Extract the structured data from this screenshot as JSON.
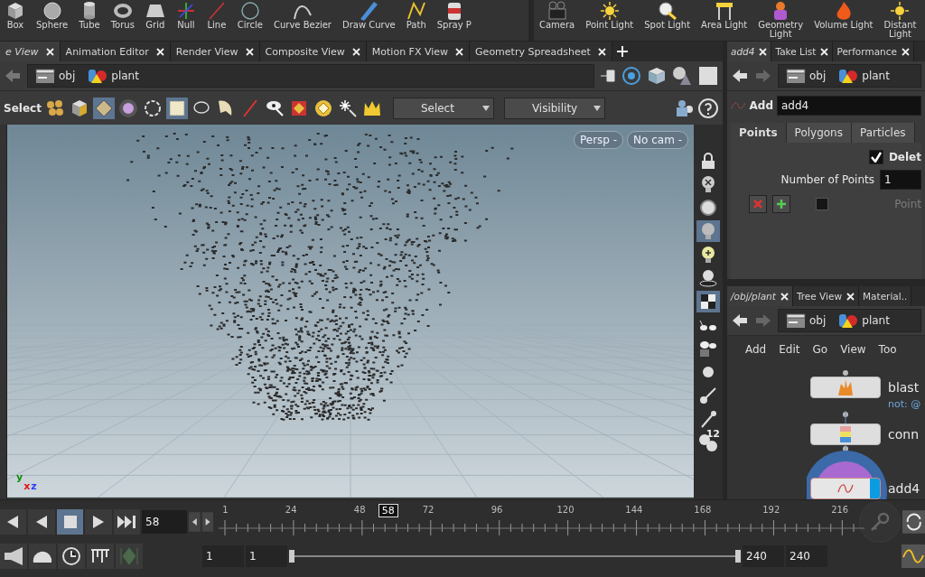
{
  "shelf_tools": [
    {
      "label": "Box"
    },
    {
      "label": "Sphere"
    },
    {
      "label": "Tube"
    },
    {
      "label": "Torus"
    },
    {
      "label": "Grid"
    },
    {
      "label": "Null"
    },
    {
      "label": "Line"
    },
    {
      "label": "Circle"
    },
    {
      "label": "Curve Bezier"
    },
    {
      "label": "Draw Curve"
    },
    {
      "label": "Path"
    },
    {
      "label": "Spray P"
    }
  ],
  "light_tools": [
    {
      "label": "Camera"
    },
    {
      "label": "Point Light"
    },
    {
      "label": "Spot Light"
    },
    {
      "label": "Area Light"
    },
    {
      "label": "Geometry\nLight"
    },
    {
      "label": "Volume Light"
    },
    {
      "label": "Distant\nLight"
    }
  ],
  "viewer_tabs": [
    {
      "label": "e View",
      "selected": true
    },
    {
      "label": "Animation Editor",
      "selected": false
    },
    {
      "label": "Render View",
      "selected": false
    },
    {
      "label": "Composite View",
      "selected": false
    },
    {
      "label": "Motion FX View",
      "selected": false
    },
    {
      "label": "Geometry Spreadsheet",
      "selected": false
    }
  ],
  "viewer_path": [
    "obj",
    "plant"
  ],
  "viewer_toolbar": {
    "label": "Select",
    "tools": [
      {
        "selected": false
      },
      {
        "selected": false
      },
      {
        "selected": true
      },
      {
        "selected": false
      },
      {
        "selected": false
      },
      {
        "selected": true
      },
      {
        "selected": false
      },
      {
        "selected": false
      },
      {
        "selected": false
      },
      {
        "selected": false
      },
      {
        "selected": false
      },
      {
        "selected": false
      },
      {
        "selected": false
      },
      {
        "selected": false
      }
    ],
    "dropdowns": [
      "Select",
      "Visibility"
    ]
  },
  "viewport": {
    "camera_buttons": [
      "Persp -",
      "No cam -"
    ],
    "axes": [
      "y",
      "x",
      "z"
    ],
    "display_tools": [
      {
        "selected": false
      },
      {
        "selected": false
      },
      {
        "selected": false
      },
      {
        "selected": true
      },
      {
        "selected": false
      },
      {
        "selected": false
      },
      {
        "selected": true
      },
      {
        "selected": false
      },
      {
        "selected": false
      },
      {
        "selected": false
      },
      {
        "selected": false
      },
      {
        "selected": false
      },
      {
        "selected": false
      }
    ],
    "point_count_label": "12"
  },
  "parameter_tabs": [
    {
      "label": "add4",
      "selected": true
    },
    {
      "label": "Take List",
      "selected": false
    },
    {
      "label": "Performance",
      "selected": false
    }
  ],
  "parameter_path": [
    "obj",
    "plant"
  ],
  "node": {
    "type": "Add",
    "name": "add4"
  },
  "parm_tabs": [
    {
      "label": "Points",
      "selected": true
    },
    {
      "label": "Polygons",
      "selected": false
    },
    {
      "label": "Particles",
      "selected": false
    }
  ],
  "params": {
    "delete_label": "Delet",
    "delete_checked": true,
    "points_label": "Number of Points",
    "points_value": "1",
    "point_label": "Point"
  },
  "network_tabs": [
    {
      "label": "/obj/plant",
      "selected": true
    },
    {
      "label": "Tree View",
      "selected": false
    },
    {
      "label": "Material..",
      "selected": false
    }
  ],
  "network_path": [
    "obj",
    "plant"
  ],
  "network_menu": [
    "Add",
    "Edit",
    "Go",
    "View",
    "Too"
  ],
  "nodes": [
    {
      "name": "blast",
      "comment": "not: @",
      "selected": false
    },
    {
      "name": "conn",
      "selected": false
    },
    {
      "name": "add4",
      "selected": true
    }
  ],
  "timeline": {
    "playback": [
      {
        "selected": false
      },
      {
        "selected": false
      },
      {
        "selected": true
      },
      {
        "selected": false
      },
      {
        "selected": false
      }
    ],
    "frame": "58",
    "ticks": [
      "1",
      "24",
      "48",
      "72",
      "96",
      "120",
      "144",
      "168",
      "192",
      "216"
    ],
    "current": "58",
    "range": [
      "1",
      "1",
      "240",
      "240"
    ]
  }
}
